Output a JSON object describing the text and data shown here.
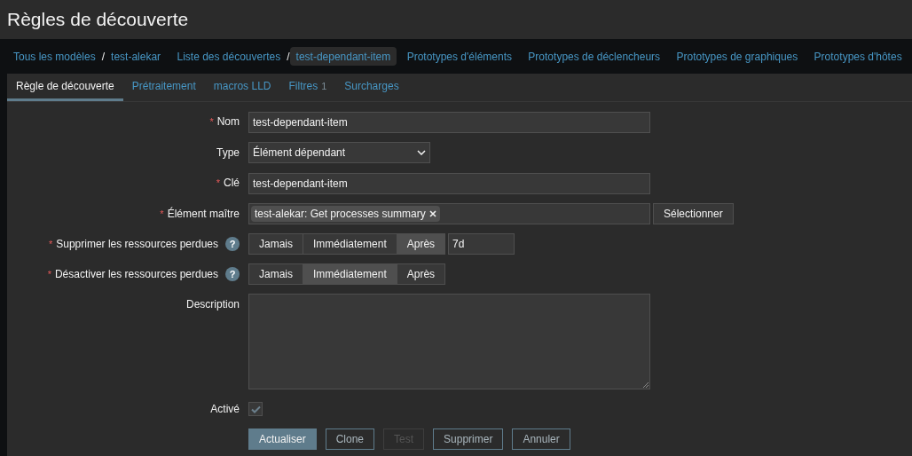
{
  "page_title": "Règles de découverte",
  "breadcrumbs": [
    {
      "label": "Tous les modèles",
      "selected": false,
      "separator_after": "/"
    },
    {
      "label": "test-alekar",
      "selected": false
    },
    {
      "label": "Liste des découvertes",
      "selected": false,
      "separator_after": "/"
    },
    {
      "label": "test-dependant-item",
      "selected": true
    },
    {
      "label": "Prototypes d'éléments",
      "selected": false
    },
    {
      "label": "Prototypes de déclencheurs",
      "selected": false
    },
    {
      "label": "Prototypes de graphiques",
      "selected": false
    },
    {
      "label": "Prototypes d'hôtes",
      "selected": false
    }
  ],
  "tabs": [
    {
      "label": "Règle de découverte",
      "selected": true
    },
    {
      "label": "Prétraitement",
      "selected": false
    },
    {
      "label": "macros LLD",
      "selected": false
    },
    {
      "label": "Filtres",
      "count": "1",
      "selected": false
    },
    {
      "label": "Surcharges",
      "selected": false
    }
  ],
  "fields": [
    {
      "kind": "text",
      "label": "Nom",
      "required_mark": "*",
      "value": "test-dependant-item"
    },
    {
      "kind": "select",
      "label": "Type",
      "value": "Élément dépendant"
    },
    {
      "kind": "text",
      "label": "Clé",
      "required_mark": "*",
      "value": "test-dependant-item"
    },
    {
      "kind": "multiselect",
      "label": "Élément maître",
      "required_mark": "*",
      "tag": "test-alekar: Get processes summary",
      "button": "Sélectionner"
    },
    {
      "kind": "segmented",
      "label": "Supprimer les ressources perdues",
      "required_mark": "*",
      "help": "?",
      "options": [
        {
          "label": "Jamais",
          "selected": false
        },
        {
          "label": "Immédiatement",
          "selected": false
        },
        {
          "label": "Après",
          "selected": true
        }
      ],
      "extra_value": "7d"
    },
    {
      "kind": "segmented",
      "label": "Désactiver les ressources perdues",
      "required_mark": "*",
      "help": "?",
      "options": [
        {
          "label": "Jamais",
          "selected": false
        },
        {
          "label": "Immédiatement",
          "selected": true
        },
        {
          "label": "Après",
          "selected": false
        }
      ]
    },
    {
      "kind": "textarea",
      "label": "Description"
    },
    {
      "kind": "checkbox",
      "label": "Activé",
      "checked": true
    }
  ],
  "buttons": [
    {
      "label": "Actualiser",
      "kind": "primary",
      "disabled": false
    },
    {
      "label": "Clone",
      "kind": "secondary",
      "disabled": false
    },
    {
      "label": "Test",
      "kind": "secondary",
      "disabled": true
    },
    {
      "label": "Supprimer",
      "kind": "secondary",
      "disabled": false
    },
    {
      "label": "Annuler",
      "kind": "secondary",
      "disabled": false
    }
  ]
}
